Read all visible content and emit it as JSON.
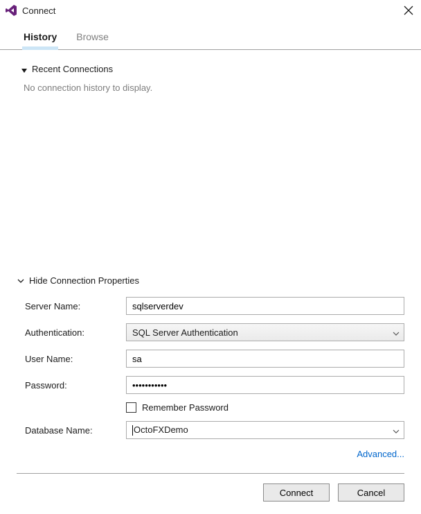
{
  "window": {
    "title": "Connect"
  },
  "tabs": {
    "history": "History",
    "browse": "Browse"
  },
  "recent": {
    "header": "Recent Connections",
    "empty": "No connection history to display."
  },
  "props": {
    "toggle": "Hide Connection Properties",
    "labels": {
      "server": "Server Name:",
      "auth": "Authentication:",
      "user": "User Name:",
      "password": "Password:",
      "remember": "Remember Password",
      "database": "Database Name:"
    },
    "values": {
      "server": "sqlserverdev",
      "auth": "SQL Server Authentication",
      "user": "sa",
      "password": "•••••••••••",
      "database": "OctoFXDemo"
    }
  },
  "links": {
    "advanced": "Advanced..."
  },
  "buttons": {
    "connect": "Connect",
    "cancel": "Cancel"
  }
}
